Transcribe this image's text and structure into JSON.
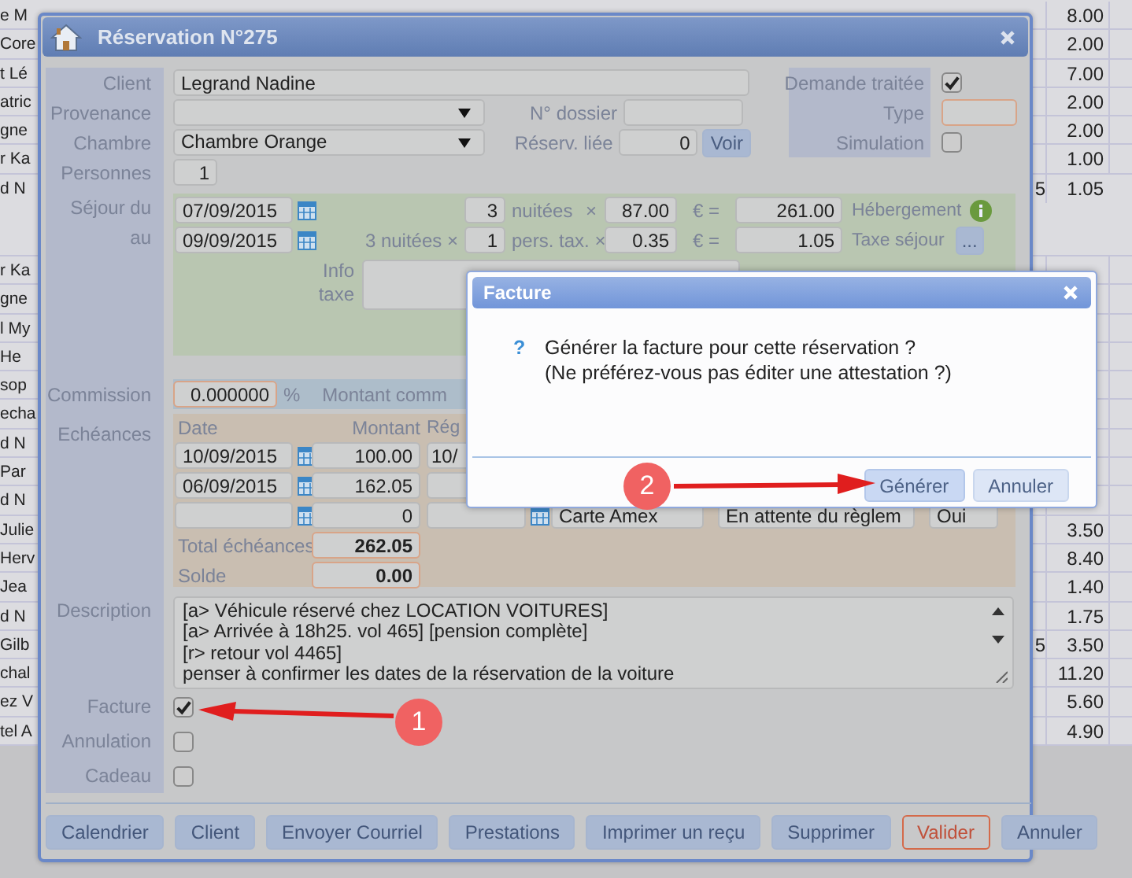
{
  "background_table": {
    "groups": [
      {
        "rows": [
          {
            "column_1": "e M",
            "column_3": "8.00"
          },
          {
            "column_1": "Core",
            "column_3": "2.00"
          },
          {
            "column_1": "t Lé",
            "column_3": "7.00"
          },
          {
            "column_1": "atric",
            "column_3": "2.00"
          },
          {
            "column_1": "gne",
            "column_3": "2.00"
          },
          {
            "column_1": "r Ka",
            "column_3": "1.00"
          },
          {
            "column_1": "d N",
            "column_2": "5",
            "column_3": "1.05"
          }
        ]
      },
      {
        "rows": [
          {
            "column_1": "r Ka"
          },
          {
            "column_1": "gne"
          },
          {
            "column_1": "l My"
          },
          {
            "column_1": "He"
          },
          {
            "column_1": "sop"
          },
          {
            "column_1": "echa"
          },
          {
            "column_1": "d N"
          },
          {
            "column_1": "Par"
          },
          {
            "column_1": "d N"
          },
          {
            "column_1": "Julie",
            "column_3": "3.50"
          },
          {
            "column_1": "Herv",
            "column_3": "8.40"
          },
          {
            "column_1": "Jea",
            "column_3": "1.40"
          },
          {
            "column_1": "d N",
            "column_3": "1.75"
          },
          {
            "column_1": "Gilb",
            "column_2": "5",
            "column_3": "3.50"
          },
          {
            "column_1": "chal",
            "column_3": "11.20"
          },
          {
            "column_1": "ez V",
            "column_3": "5.60"
          },
          {
            "column_1": "tel A",
            "column_3": "4.90"
          }
        ]
      }
    ]
  },
  "reservation": {
    "title": "Réservation N°275",
    "client": {
      "label": "Client",
      "value": "Legrand Nadine"
    },
    "provenance": {
      "label": "Provenance"
    },
    "dossier": {
      "label": "N° dossier"
    },
    "chambre": {
      "label": "Chambre",
      "value": "Chambre Orange"
    },
    "reserv_liee": {
      "label": "Réserv. liée",
      "value": "0",
      "button": "Voir"
    },
    "personnes": {
      "label": "Personnes",
      "value": "1"
    },
    "flags": [
      {
        "label": "Demande traitée",
        "kind": "checkbox",
        "checked": true
      },
      {
        "label": "Type",
        "kind": "field"
      },
      {
        "label": "Simulation",
        "kind": "checkbox",
        "checked": false
      }
    ],
    "sejour": {
      "label_from": "Séjour du",
      "label_to": "au",
      "date_from": "07/09/2015",
      "date_to": "09/09/2015",
      "lines": [
        {
          "value": "3",
          "unit": "nuitées",
          "times": "×",
          "price": "87.00",
          "equals": "€ =",
          "total": "261.00",
          "label": "Hébergement",
          "kind": "info"
        },
        {
          "prefix": "3 nuitées ×",
          "value": "1",
          "unit": "pers. tax. ×",
          "price": "0.35",
          "equals": "€ =",
          "total": "1.05",
          "label": "Taxe séjour",
          "kind": "button",
          "button": "..."
        }
      ],
      "info_label": "Info taxe"
    },
    "commission": {
      "label": "Commission",
      "value": "0.000000",
      "unit": "%",
      "amount_label": "Montant comm"
    },
    "echeances": {
      "label": "Echéances",
      "columns": [
        "Date",
        "Montant",
        "Rég"
      ],
      "rows": [
        {
          "date": "10/09/2015",
          "amount": "100.00",
          "column_3": "10/"
        },
        {
          "date": "06/09/2015",
          "amount": "162.05"
        },
        {
          "amount": "0",
          "column_4": "Carte Amex",
          "column_5": "En attente du règlem",
          "column_6": "Oui"
        }
      ],
      "total_label": "Total échéances",
      "total": "262.05",
      "balance_label": "Solde",
      "balance": "0.00"
    },
    "description": {
      "label": "Description",
      "value": "[a> Véhicule réservé chez LOCATION VOITURES]\n[a> Arrivée à 18h25. vol 465] [pension complète]\n[r> retour  vol 4465]\npenser à confirmer les dates de la réservation de la voiture"
    },
    "options": [
      {
        "label": "Facture",
        "checked": true
      },
      {
        "label": "Annulation",
        "checked": false
      },
      {
        "label": "Cadeau",
        "checked": false
      }
    ],
    "buttons": [
      {
        "label": "Calendrier",
        "kind": "normal"
      },
      {
        "label": "Client",
        "kind": "normal"
      },
      {
        "label": "Envoyer Courriel",
        "kind": "normal"
      },
      {
        "label": "Prestations",
        "kind": "normal"
      },
      {
        "label": "Imprimer un reçu",
        "kind": "normal"
      },
      {
        "label": "Supprimer",
        "kind": "normal"
      },
      {
        "label": "Valider",
        "kind": "primary"
      },
      {
        "label": "Annuler",
        "kind": "normal"
      }
    ]
  },
  "dialog": {
    "title": "Facture",
    "icon": "?",
    "message": "Générer la facture pour cette réservation ?\n(Ne préférez-vous pas éditer une attestation ?)",
    "buttons": [
      {
        "label": "Générer",
        "focused": true
      },
      {
        "label": "Annuler",
        "focused": false
      }
    ]
  },
  "annotations": [
    {
      "number": "1"
    },
    {
      "number": "2"
    }
  ]
}
